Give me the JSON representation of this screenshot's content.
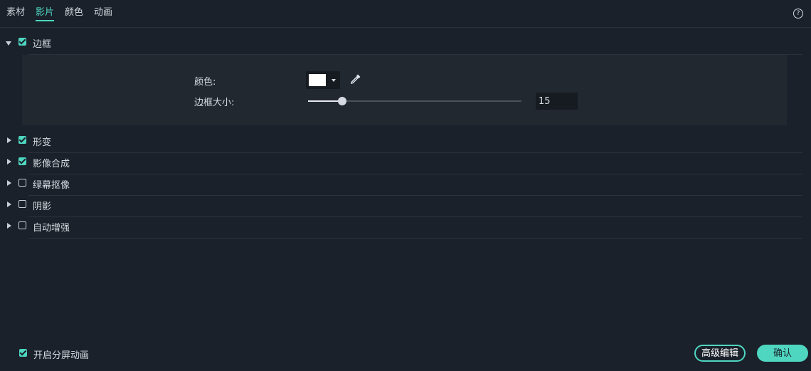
{
  "tabs": [
    {
      "label": "素材",
      "active": false
    },
    {
      "label": "影片",
      "active": true
    },
    {
      "label": "颜色",
      "active": false
    },
    {
      "label": "动画",
      "active": false
    }
  ],
  "help": {
    "icon": "help-icon",
    "glyph": "?"
  },
  "sections": [
    {
      "label": "边框",
      "checked": true,
      "expanded": true
    },
    {
      "label": "形变",
      "checked": true,
      "expanded": false
    },
    {
      "label": "影像合成",
      "checked": true,
      "expanded": false
    },
    {
      "label": "绿幕抠像",
      "checked": false,
      "expanded": false
    },
    {
      "label": "阴影",
      "checked": false,
      "expanded": false
    },
    {
      "label": "自动增强",
      "checked": false,
      "expanded": false
    }
  ],
  "border_panel": {
    "color_label": "颜色:",
    "color_value": "#ffffff",
    "size_label": "边框大小:",
    "size_value": "15",
    "size_fraction": 0.16
  },
  "footer": {
    "split_screen_label": "开启分屏动画",
    "split_screen_checked": true,
    "advanced_button": "高级编辑",
    "ok_button": "确认"
  },
  "colors": {
    "accent": "#4fd6c1",
    "background": "#1b212a"
  }
}
